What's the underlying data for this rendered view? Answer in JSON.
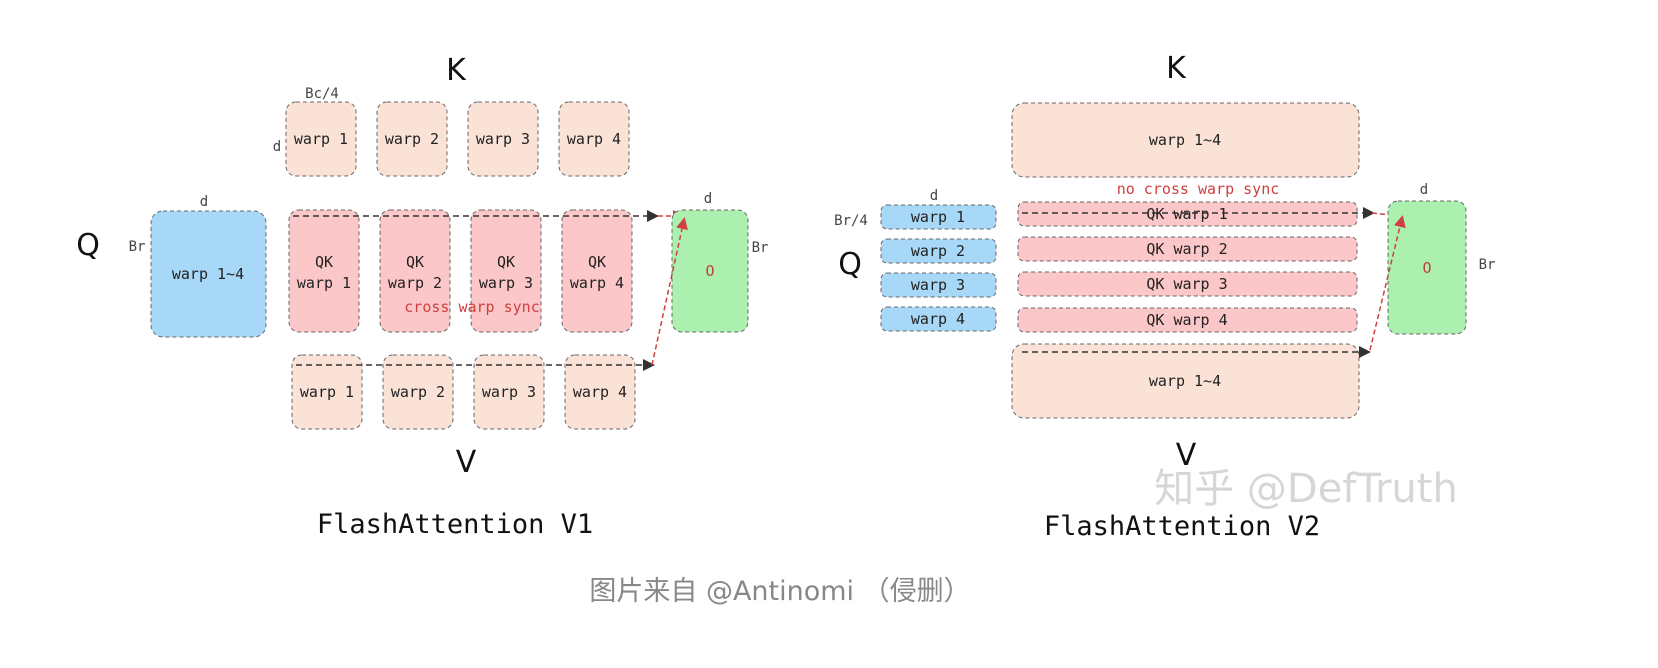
{
  "colors": {
    "blue": "#a8d8f8",
    "peach": "#fae3d6",
    "pink": "#fcc7c9",
    "green": "#acf0b0",
    "red": "#d04040",
    "edge": "#666666",
    "watermark": "#cccccc",
    "caption": "#888888"
  },
  "v1": {
    "k_label": "K",
    "q_label": "Q",
    "v_label": "V",
    "bc_label": "Bc/4",
    "d_k": "d",
    "d_q": "d",
    "br_q": "Br",
    "d_o": "d",
    "br_o": "Br",
    "k_warps": [
      "warp 1",
      "warp 2",
      "warp 3",
      "warp 4"
    ],
    "q_block": "warp 1~4",
    "qk": [
      [
        "QK",
        "warp 1"
      ],
      [
        "QK",
        "warp 2"
      ],
      [
        "QK",
        "warp 3"
      ],
      [
        "QK",
        "warp 4"
      ]
    ],
    "sync": "cross warp sync",
    "o": "O",
    "v_warps": [
      "warp 1",
      "warp 2",
      "warp 3",
      "warp 4"
    ],
    "title": "FlashAttention V1"
  },
  "v2": {
    "k_label": "K",
    "q_label": "Q",
    "v_label": "V",
    "k_block": "warp 1~4",
    "sync": "no cross warp sync",
    "d_q": "d",
    "brq": "Br/4",
    "q_warps": [
      "warp 1",
      "warp 2",
      "warp 3",
      "warp 4"
    ],
    "qk": [
      "QK warp 1",
      "QK warp 2",
      "QK warp 3",
      "QK warp 4"
    ],
    "d_o": "d",
    "br_o": "Br",
    "o": "O",
    "v_block": "warp 1~4",
    "title": "FlashAttention V2"
  },
  "watermark": "知乎 @DefTruth",
  "caption": "图片来自 @Antinomi （侵删）"
}
